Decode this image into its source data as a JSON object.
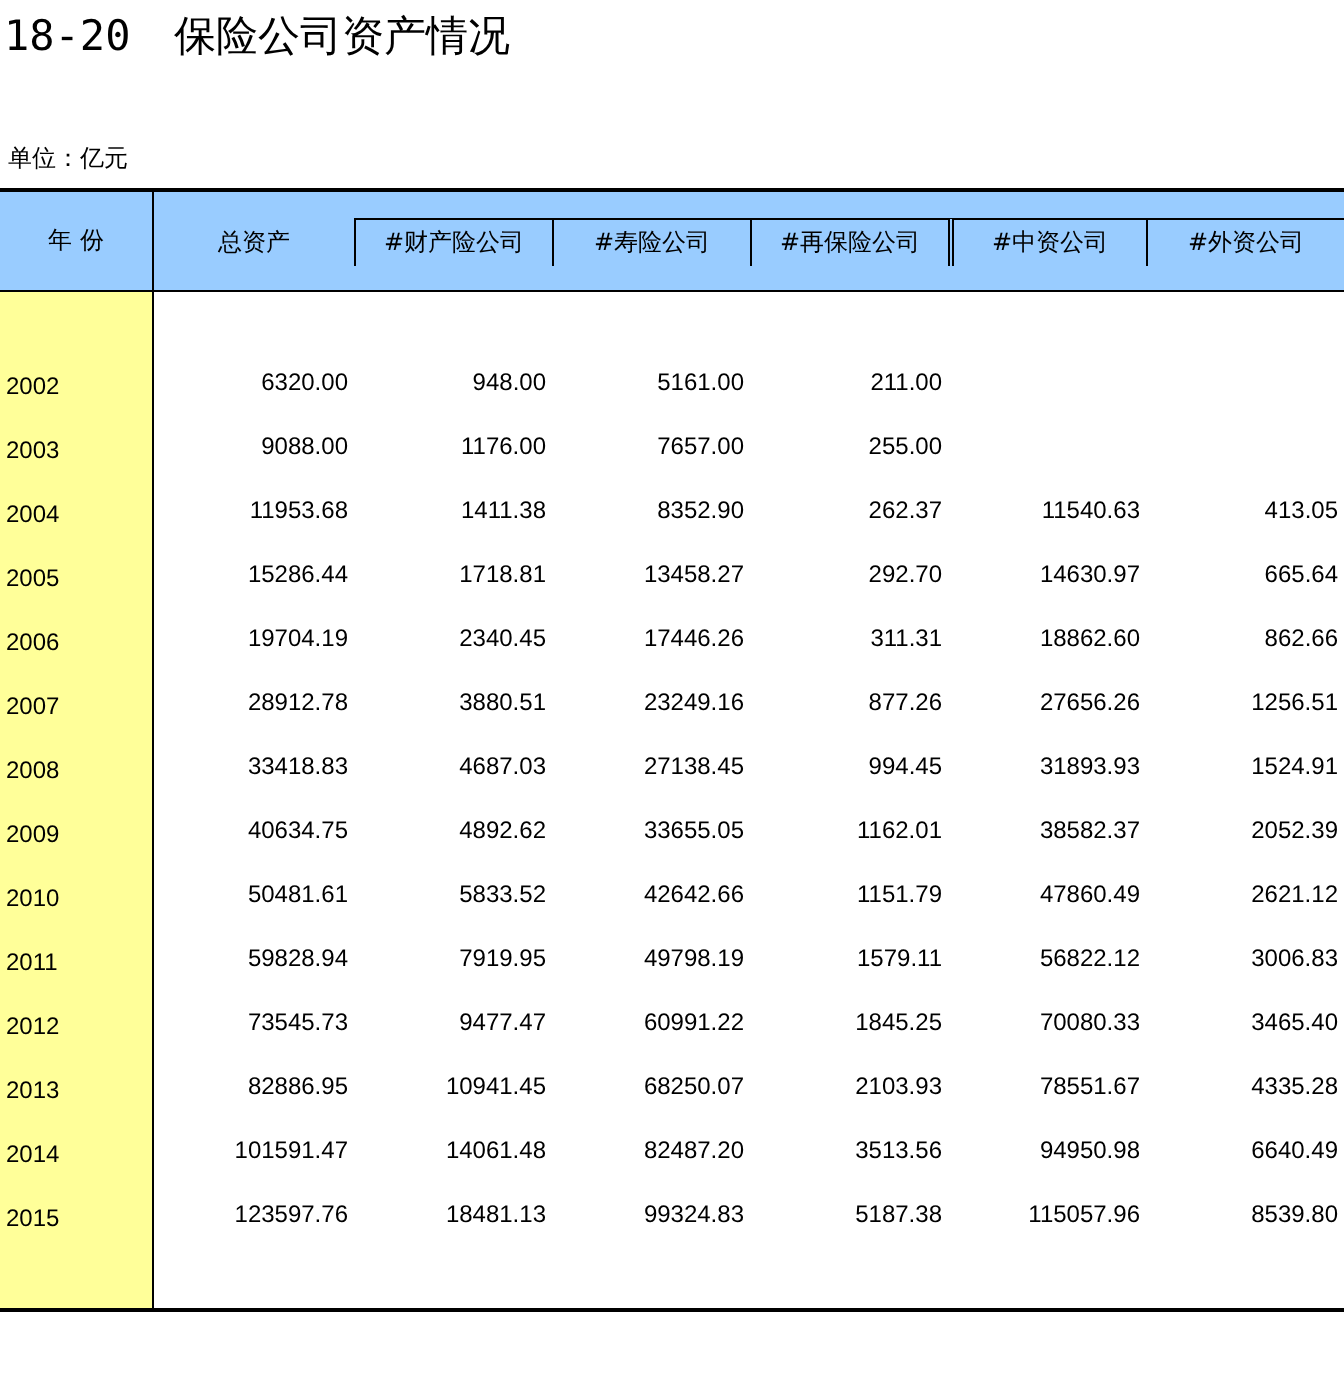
{
  "title": {
    "number": "18-20",
    "text": "保险公司资产情况"
  },
  "unit": "单位：亿元",
  "table": {
    "year_header": "年 份",
    "total_header": "总资产",
    "sub_headers": [
      "#财产险公司",
      "#寿险公司",
      "#再保险公司",
      "#中资公司",
      "#外资公司"
    ],
    "rows": [
      {
        "year": "2002",
        "total": "6320.00",
        "property": "948.00",
        "life": "5161.00",
        "reinsurance": "211.00"
      },
      {
        "year": "2003",
        "total": "9088.00",
        "property": "1176.00",
        "life": "7657.00",
        "reinsurance": "255.00"
      },
      {
        "year": "2004",
        "total": "11953.68",
        "property": "1411.38",
        "life": "8352.90",
        "reinsurance": "262.37",
        "domestic": "11540.63",
        "foreign": "413.05"
      },
      {
        "year": "2005",
        "total": "15286.44",
        "property": "1718.81",
        "life": "13458.27",
        "reinsurance": "292.70",
        "domestic": "14630.97",
        "foreign": "665.64"
      },
      {
        "year": "2006",
        "total": "19704.19",
        "property": "2340.45",
        "life": "17446.26",
        "reinsurance": "311.31",
        "domestic": "18862.60",
        "foreign": "862.66"
      },
      {
        "year": "2007",
        "total": "28912.78",
        "property": "3880.51",
        "life": "23249.16",
        "reinsurance": "877.26",
        "domestic": "27656.26",
        "foreign": "1256.51"
      },
      {
        "year": "2008",
        "total": "33418.83",
        "property": "4687.03",
        "life": "27138.45",
        "reinsurance": "994.45",
        "domestic": "31893.93",
        "foreign": "1524.91"
      },
      {
        "year": "2009",
        "total": "40634.75",
        "property": "4892.62",
        "life": "33655.05",
        "reinsurance": "1162.01",
        "domestic": "38582.37",
        "foreign": "2052.39"
      },
      {
        "year": "2010",
        "total": "50481.61",
        "property": "5833.52",
        "life": "42642.66",
        "reinsurance": "1151.79",
        "domestic": "47860.49",
        "foreign": "2621.12"
      },
      {
        "year": "2011",
        "total": "59828.94",
        "property": "7919.95",
        "life": "49798.19",
        "reinsurance": "1579.11",
        "domestic": "56822.12",
        "foreign": "3006.83"
      },
      {
        "year": "2012",
        "total": "73545.73",
        "property": "9477.47",
        "life": "60991.22",
        "reinsurance": "1845.25",
        "domestic": "70080.33",
        "foreign": "3465.40"
      },
      {
        "year": "2013",
        "total": "82886.95",
        "property": "10941.45",
        "life": "68250.07",
        "reinsurance": "2103.93",
        "domestic": "78551.67",
        "foreign": "4335.28"
      },
      {
        "year": "2014",
        "total": "101591.47",
        "property": "14061.48",
        "life": "82487.20",
        "reinsurance": "3513.56",
        "domestic": "94950.98",
        "foreign": "6640.49"
      },
      {
        "year": "2015",
        "total": "123597.76",
        "property": "18481.13",
        "life": "99324.83",
        "reinsurance": "5187.38",
        "domestic": "115057.96",
        "foreign": "8539.80"
      }
    ]
  }
}
